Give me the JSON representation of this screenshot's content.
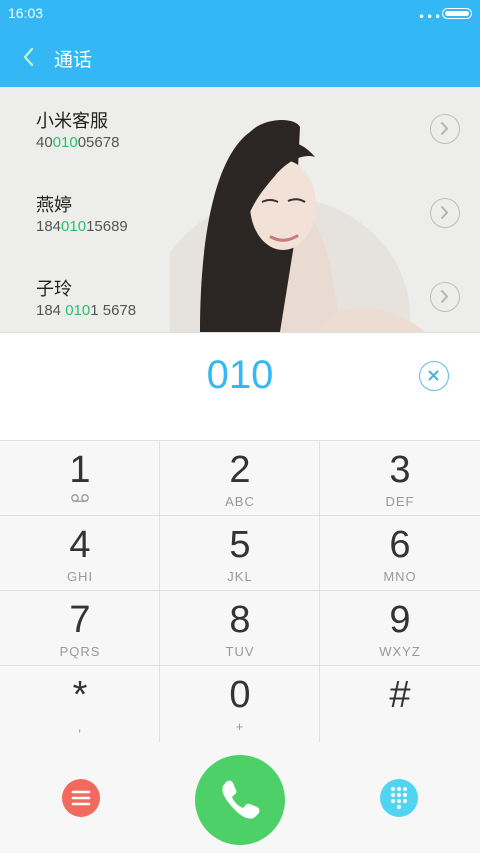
{
  "status": {
    "time": "16:03",
    "menu_dots": "•••"
  },
  "header": {
    "title": "通话"
  },
  "contacts": [
    {
      "name": "小米客服",
      "number_pre": "40",
      "number_hl": "010",
      "number_post": "05678"
    },
    {
      "name": "燕婷",
      "number_pre": "184",
      "number_hl": "010",
      "number_post": "15689"
    },
    {
      "name": "子玲",
      "number_pre": "184 ",
      "number_hl": "010",
      "number_post": "1 5678"
    }
  ],
  "entry": {
    "value": "010"
  },
  "keypad": [
    {
      "digit": "1",
      "letters": ""
    },
    {
      "digit": "2",
      "letters": "ABC"
    },
    {
      "digit": "3",
      "letters": "DEF"
    },
    {
      "digit": "4",
      "letters": "GHI"
    },
    {
      "digit": "5",
      "letters": "JKL"
    },
    {
      "digit": "6",
      "letters": "MNO"
    },
    {
      "digit": "7",
      "letters": "PQRS"
    },
    {
      "digit": "8",
      "letters": "TUV"
    },
    {
      "digit": "9",
      "letters": "WXYZ"
    },
    {
      "digit": "*",
      "letters": ","
    },
    {
      "digit": "0",
      "letters": "+"
    },
    {
      "digit": "#",
      "letters": ""
    }
  ],
  "icons": {
    "back": "chevron-left-icon",
    "voicemail": "voicemail-icon",
    "clear": "clear-icon",
    "menu": "menu-icon",
    "call": "phone-icon",
    "dialpad": "dialpad-icon"
  },
  "colors": {
    "accent": "#33b8f5",
    "highlight": "#2bbf6a",
    "call": "#4cd067",
    "menu": "#f26a5d",
    "dialpad": "#4fd5f2"
  }
}
